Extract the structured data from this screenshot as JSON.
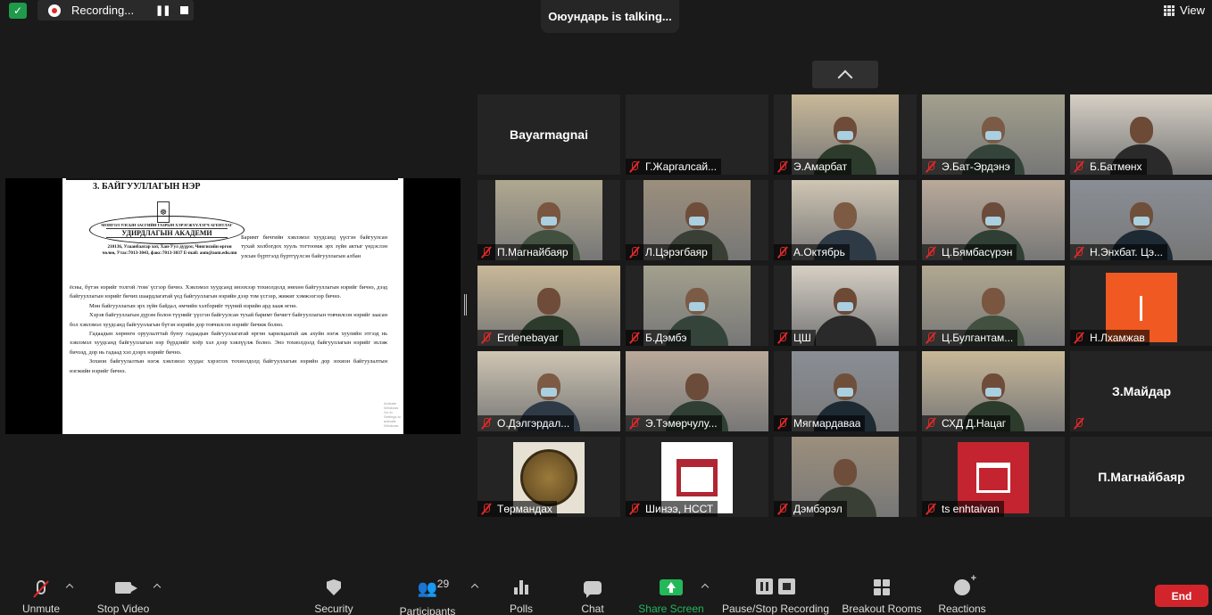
{
  "top": {
    "recording_label": "Recording...",
    "talking_text": "Оюундарь is talking...",
    "view_label": "View"
  },
  "shared_document": {
    "heading": "3. БАЙГУУЛЛАГЫН НЭР",
    "oval_line1": "МОНГОЛ УЛСЫН ЗАСГИЙН ГАЗРЫН ХЭРЭГЖҮҮЛЭГЧ АГЕНТЛАГ",
    "oval_line2": "УДИРДЛАГЫН АКАДЕМИ",
    "address": "210136, Улаанбаатар хот, Хан-Уул дүүрэг, Чингисийн өргөн чөлөө, Утас:7013-3043, факс:7013-3037 E-mail: aom@aom.edu.mn",
    "side_text": "Баримт бичгийн хэвлэмэл хуудсанд үүсгэн байгуулсан тухай холбогдох хууль тогтоомж эрх зүйн актыг үндэслэн улсын бүртгэлд бүртгүүлсэн байгууллагын албан",
    "paragraphs": [
      "ёсны, бүтэн нэрийг толгой /том/ үсгээр бичнэ. Хэвлэмэл хуудсанд инээхээр тохиолдолд зөвхөн байгууллагын нэрийг бичнэ, дээд байгууллагын нэрийг бичих шаардлагатай үед байгууллагын нэрийн дээр том үсгээр, жижиг хэмжээгээр бичнэ.",
      "Мөн байгууллагын эрх зүйн байдал, өмчийн хэлбэрийг түүний нэрийн ард зааж өгнө.",
      "Хэрэв байгууллагын дүрэм болон түүнийг үүсгэн байгуулсан тухай баримт бичигт байгууллагын товчилсон нэрийг заасан бол хэвлэмэл хуудсанд байгууллагын бүтэн нэрийн дор товчилсон нэрийг бичиж болно.",
      "Гадаадын хөрөнгө оруулалттай буюу гадаадын байгууллагатай өргөн харилцаатай аж ахуйн нэгж хуулийн этгээд нь хэвлэмэл хуудсанд байгууллагын нэр бүрдлийг хоёр хэл дээр хэвлүүлж болно. Энэ тохиолдолд байгууллагын нэрийг эхлэж бичээд, дор нь гадаад хэл дээрх нэрийг бичнэ.",
      "Зохион байгуулалтын нэгж хэвлэмэл хуудас хэрэглэх тохиолдолд байгууллагын нэрийн дор зохион байгуулалтын нэгжийн нэрийг бичнэ."
    ],
    "watermark": "Activate Windows Go to Settings to activate Windows."
  },
  "participants": [
    {
      "name": "Bayarmagnai",
      "style": "name-only",
      "muted": false
    },
    {
      "name": "Г.Жаргалсай...",
      "style": "dark",
      "muted": true
    },
    {
      "name": "Э.Амарбат",
      "style": "video",
      "muted": true
    },
    {
      "name": "Э.Бат-Эрдэнэ",
      "style": "video",
      "muted": true
    },
    {
      "name": "Б.Батмөнх",
      "style": "video",
      "muted": true
    },
    {
      "name": "П.Магнайбаяр",
      "style": "video",
      "muted": true
    },
    {
      "name": "Л.Цэрэгбаяр",
      "style": "video",
      "muted": true
    },
    {
      "name": "А.Октябрь",
      "style": "video",
      "muted": true
    },
    {
      "name": "Ц.Бямбасүрэн",
      "style": "video",
      "muted": true
    },
    {
      "name": "Н.Энхбат. Цэ...",
      "style": "video",
      "muted": true
    },
    {
      "name": "Erdenebayar",
      "style": "video",
      "muted": true
    },
    {
      "name": "Б.Дэмбэ",
      "style": "video",
      "muted": true
    },
    {
      "name": "ЦШ",
      "style": "video",
      "muted": true
    },
    {
      "name": "Ц.Булгантам...",
      "style": "video",
      "muted": true
    },
    {
      "name": "Н.Лхамжав",
      "style": "orange",
      "muted": true
    },
    {
      "name": "О.Дэлгэрдал...",
      "style": "video",
      "muted": true
    },
    {
      "name": "Э.Тэмөрчулу...",
      "style": "video",
      "muted": true
    },
    {
      "name": "Мягмардаваа",
      "style": "video",
      "muted": true
    },
    {
      "name": "СХД Д.Нацаг",
      "style": "video",
      "muted": true
    },
    {
      "name": "З.Майдар",
      "style": "name-only",
      "muted": true
    },
    {
      "name": "Төрмандах",
      "style": "coin",
      "muted": true
    },
    {
      "name": "Шинээ, НССТ",
      "style": "logo-white",
      "muted": true
    },
    {
      "name": "Дэмбэрэл",
      "style": "video",
      "muted": true
    },
    {
      "name": "ts enhtaivan",
      "style": "logo-red",
      "muted": true
    },
    {
      "name": "П.Магнайбаяр",
      "style": "name-only",
      "muted": false
    }
  ],
  "toolbar": {
    "unmute": "Unmute",
    "stop_video": "Stop Video",
    "security": "Security",
    "participants": "Participants",
    "participants_count": "29",
    "polls": "Polls",
    "chat": "Chat",
    "share_screen": "Share Screen",
    "pause_stop_recording": "Pause/Stop Recording",
    "breakout_rooms": "Breakout Rooms",
    "reactions": "Reactions",
    "end": "End"
  },
  "colors": {
    "accent_green": "#23b85a",
    "end_red": "#d2252b",
    "muted_red": "#e02828",
    "background": "#1a1a1a"
  }
}
